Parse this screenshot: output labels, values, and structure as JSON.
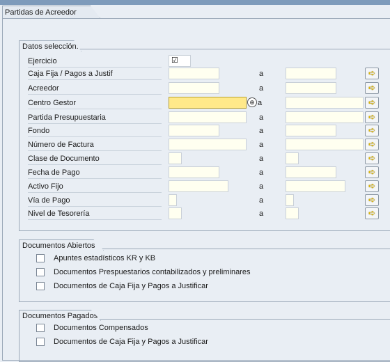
{
  "main_tab": "Partidas de Acreedor",
  "datos": {
    "title": "Datos selección:",
    "ejercicio_label": "Ejercicio",
    "ejercicio_mark": "☑",
    "rows": [
      {
        "label": "Caja Fija / Pagos a Justif",
        "a": "a"
      },
      {
        "label": "Acreedor",
        "a": "a"
      },
      {
        "label": "Centro Gestor",
        "a": "a"
      },
      {
        "label": "Partida Presupuestaria",
        "a": "a"
      },
      {
        "label": "Fondo",
        "a": "a"
      },
      {
        "label": "Número de Factura",
        "a": "a"
      },
      {
        "label": "Clase de Documento",
        "a": "a"
      },
      {
        "label": "Fecha de Pago",
        "a": "a"
      },
      {
        "label": "Activo Fijo",
        "a": "a"
      },
      {
        "label": "Vía de Pago",
        "a": "a"
      },
      {
        "label": "Nivel de Tesorería",
        "a": "a"
      }
    ]
  },
  "abiertos": {
    "title": "Documentos Abiertos",
    "items": [
      "Apuntes estadísticos KR y KB",
      "Documentos Prespuestarios contabilizados y preliminares",
      "Documentos de Caja Fija y Pagos a Justificar"
    ]
  },
  "pagados": {
    "title": "Documentos Pagados",
    "items": [
      "Documentos Compensados",
      "Documentos de Caja Fija y Pagos a Justificar"
    ]
  },
  "icons": {
    "arrow": "multiple-selection-arrow-icon",
    "match": "matchcode-icon"
  },
  "colors": {
    "focus_field": "#ffe98a",
    "input_bg": "#fffff0",
    "frame_bg": "#e9eef4",
    "arrow": "#e0b800"
  }
}
